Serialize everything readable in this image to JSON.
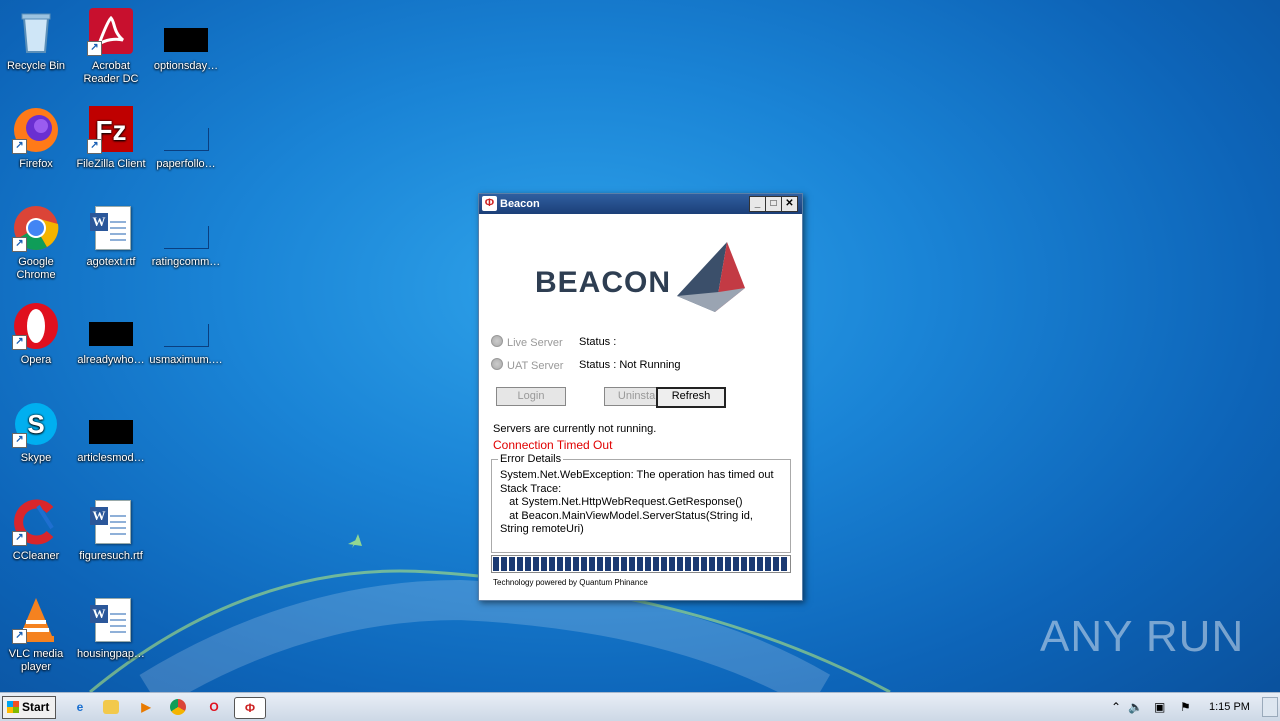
{
  "desktop": {
    "icons": [
      {
        "label": "Recycle Bin",
        "icon": "recycle-bin-icon"
      },
      {
        "label": "Acrobat Reader DC",
        "icon": "acrobat-icon"
      },
      {
        "label": "optionsday…",
        "icon": "black-file-icon"
      },
      {
        "label": "Firefox",
        "icon": "firefox-icon"
      },
      {
        "label": "FileZilla Client",
        "icon": "filezilla-icon"
      },
      {
        "label": "paperfollo…",
        "icon": "blank-file-icon"
      },
      {
        "label": "Google Chrome",
        "icon": "chrome-icon"
      },
      {
        "label": "agotext.rtf",
        "icon": "word-doc-icon"
      },
      {
        "label": "ratingcomm…",
        "icon": "blank-file-icon"
      },
      {
        "label": "Opera",
        "icon": "opera-icon"
      },
      {
        "label": "alreadywho…",
        "icon": "black-file-icon"
      },
      {
        "label": "usmaximum.…",
        "icon": "blank-file-icon"
      },
      {
        "label": "Skype",
        "icon": "skype-icon"
      },
      {
        "label": "articlesmod…",
        "icon": "black-file-icon"
      },
      {
        "label": "CCleaner",
        "icon": "ccleaner-icon"
      },
      {
        "label": "figuresuch.rtf",
        "icon": "word-doc-icon"
      },
      {
        "label": "VLC media player",
        "icon": "vlc-icon"
      },
      {
        "label": "housingpap…",
        "icon": "word-doc-icon"
      }
    ]
  },
  "window": {
    "title": "Beacon",
    "logo_text": "BEACON",
    "radio_live": "Live Server",
    "radio_uat": "UAT Server",
    "status_live": "Status :",
    "status_uat": "Status :  Not Running",
    "btn_login": "Login",
    "btn_uninstall": "Uninstall",
    "btn_refresh": "Refresh",
    "message": "Servers are currently not running.",
    "error": "Connection Timed Out",
    "error_color": "#e00000",
    "details_legend": "Error Details",
    "details_text": "System.Net.WebException: The operation has timed out\nStack Trace:\n   at System.Net.HttpWebRequest.GetResponse()\n   at Beacon.MainViewModel.ServerStatus(String id, String remoteUri)",
    "progress": 1.0,
    "footer": "Technology powered by Quantum Phinance"
  },
  "taskbar": {
    "start_label": "Start",
    "clock": "1:15 PM"
  },
  "watermark": "ANY RUN"
}
